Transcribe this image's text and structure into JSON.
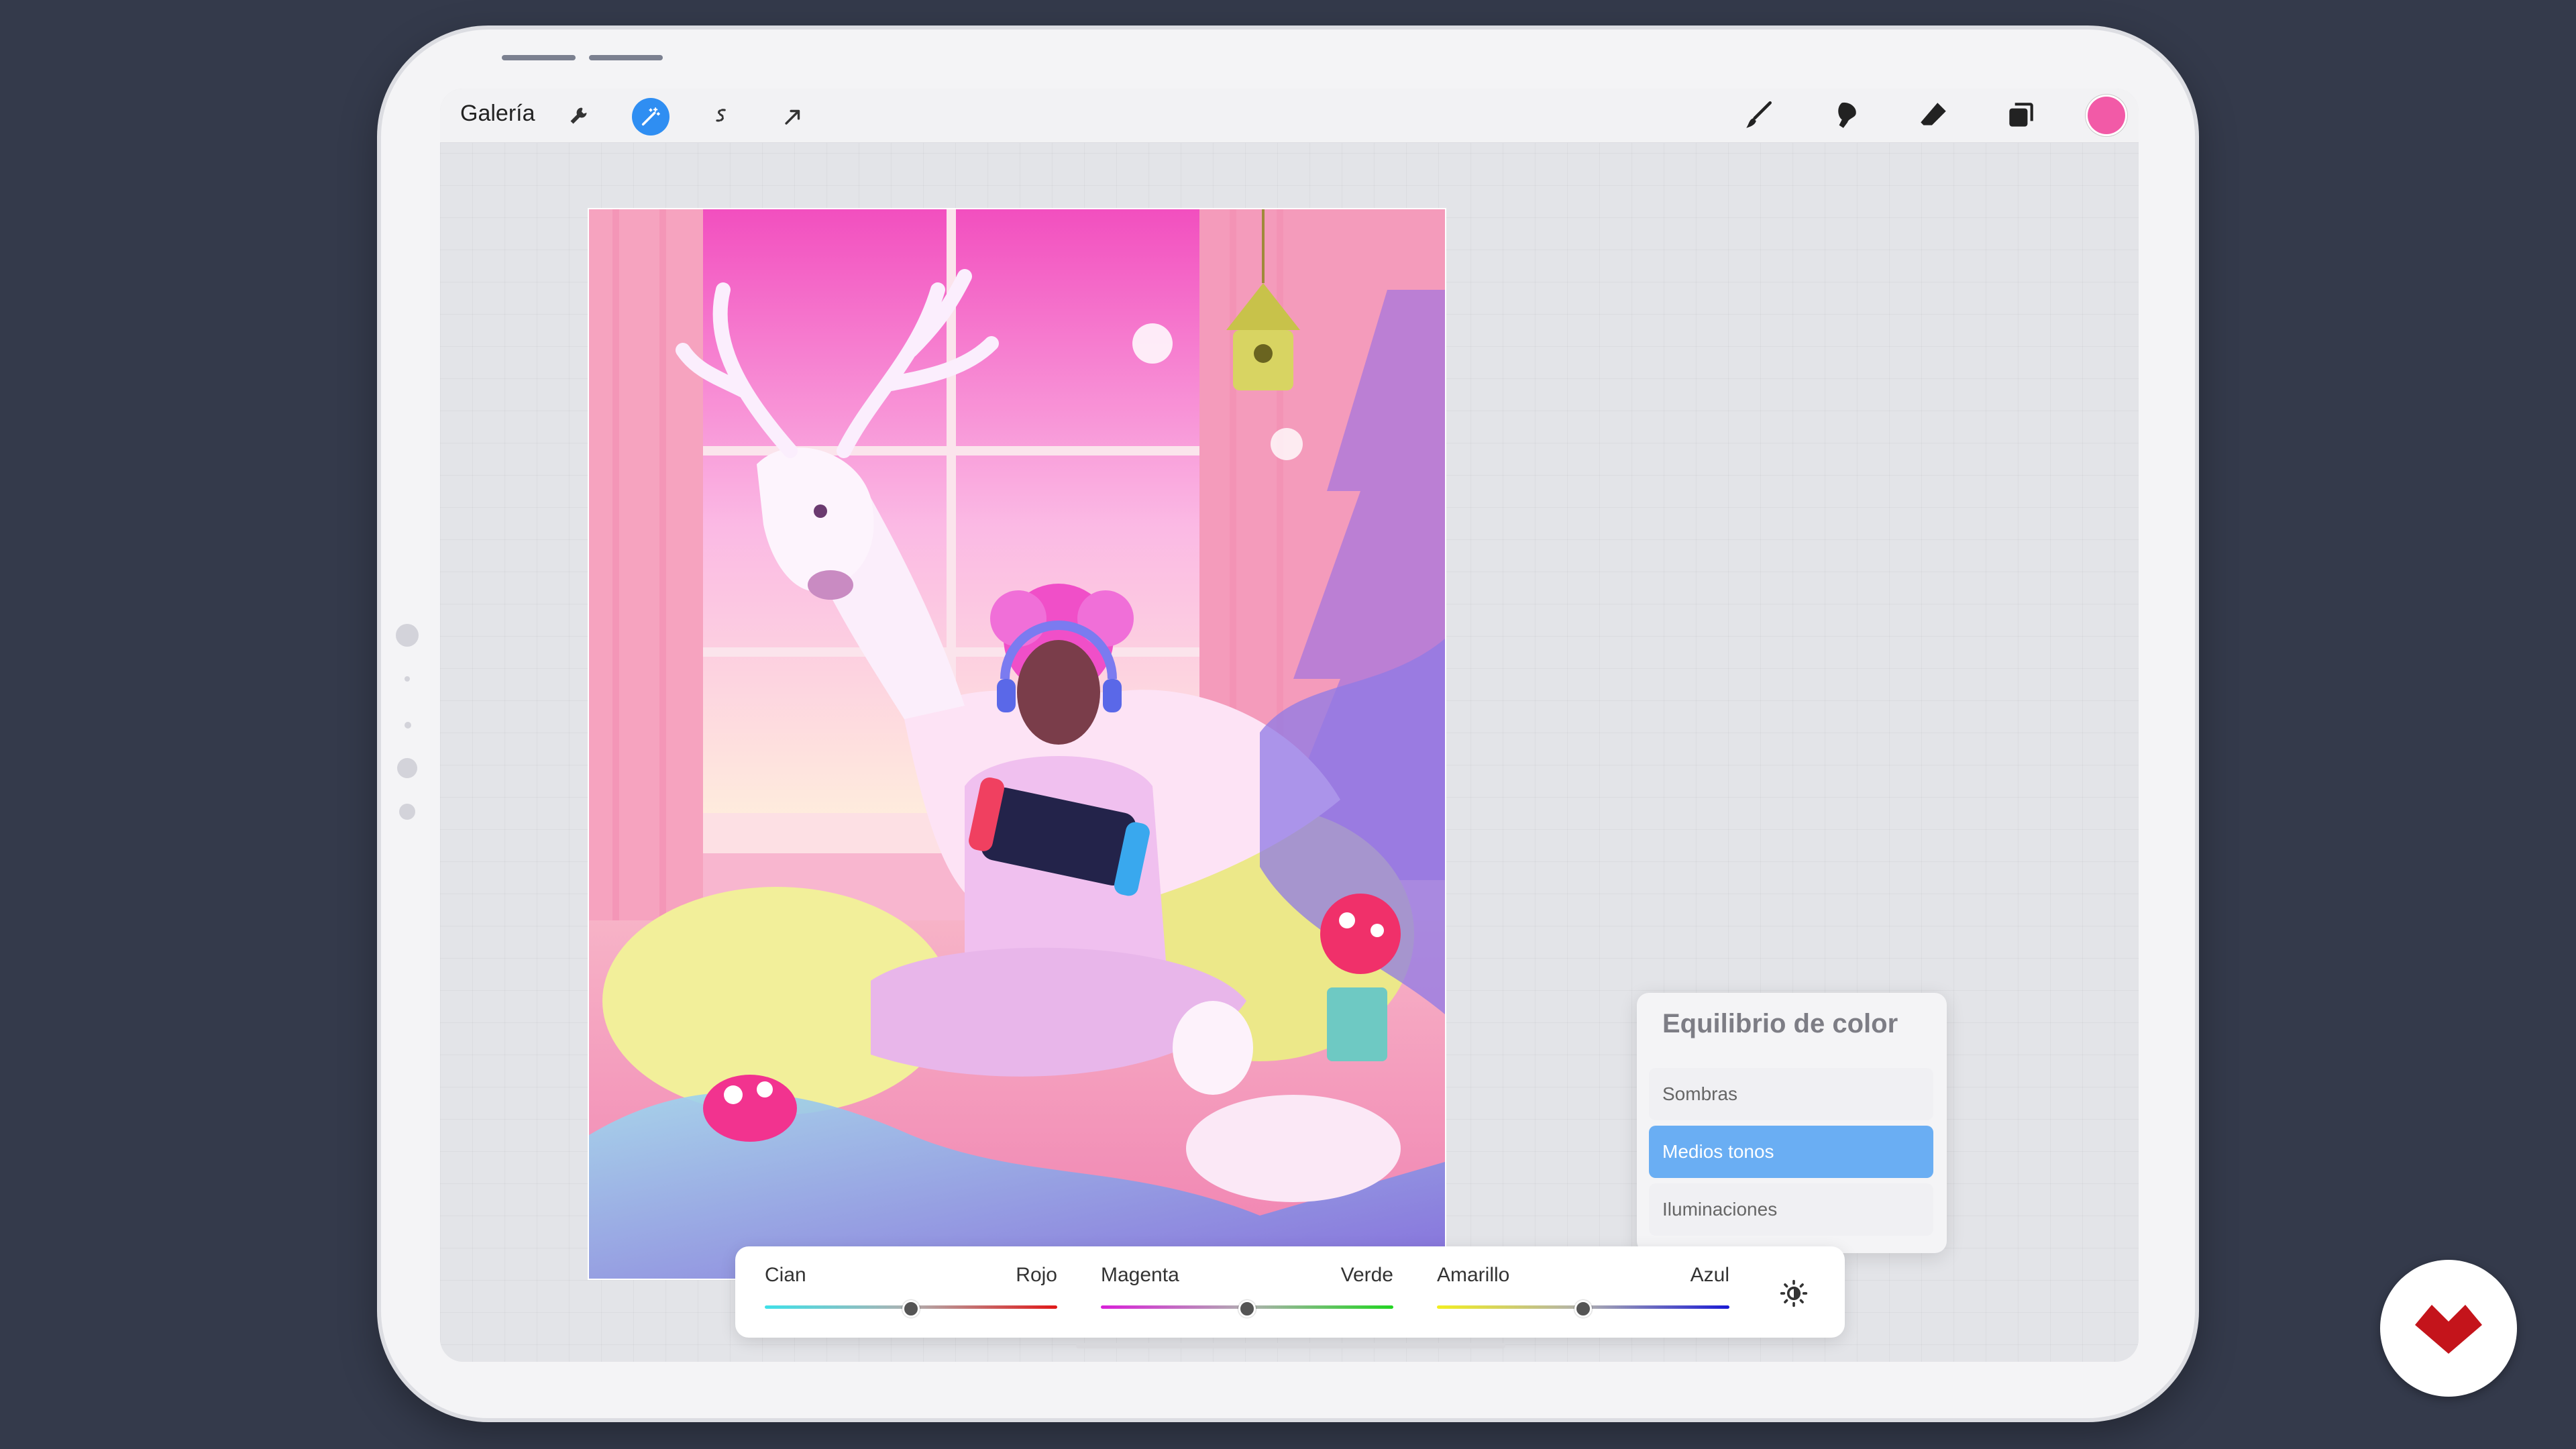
{
  "toolbar": {
    "gallery_label": "Galería",
    "left_icons": [
      "wrench-icon",
      "magic-wand-icon",
      "selection-icon",
      "transform-arrow-icon"
    ],
    "right_icons": [
      "brush-icon",
      "smudge-icon",
      "eraser-icon",
      "layers-icon"
    ],
    "current_color": "#f25aa7"
  },
  "color_balance": {
    "sliders": [
      {
        "left": "Cian",
        "right": "Rojo",
        "position": 0.5
      },
      {
        "left": "Magenta",
        "right": "Verde",
        "position": 0.5
      },
      {
        "left": "Amarillo",
        "right": "Azul",
        "position": 0.5
      }
    ],
    "tone_button_icon": "sun-icon"
  },
  "popover": {
    "title": "Equilibrio de color",
    "items": [
      "Sombras",
      "Medios tonos",
      "Iluminaciones"
    ],
    "selected_item": "Medios tonos"
  },
  "brand": {
    "icon": "brand-logo-icon",
    "color": "#c4141b"
  }
}
